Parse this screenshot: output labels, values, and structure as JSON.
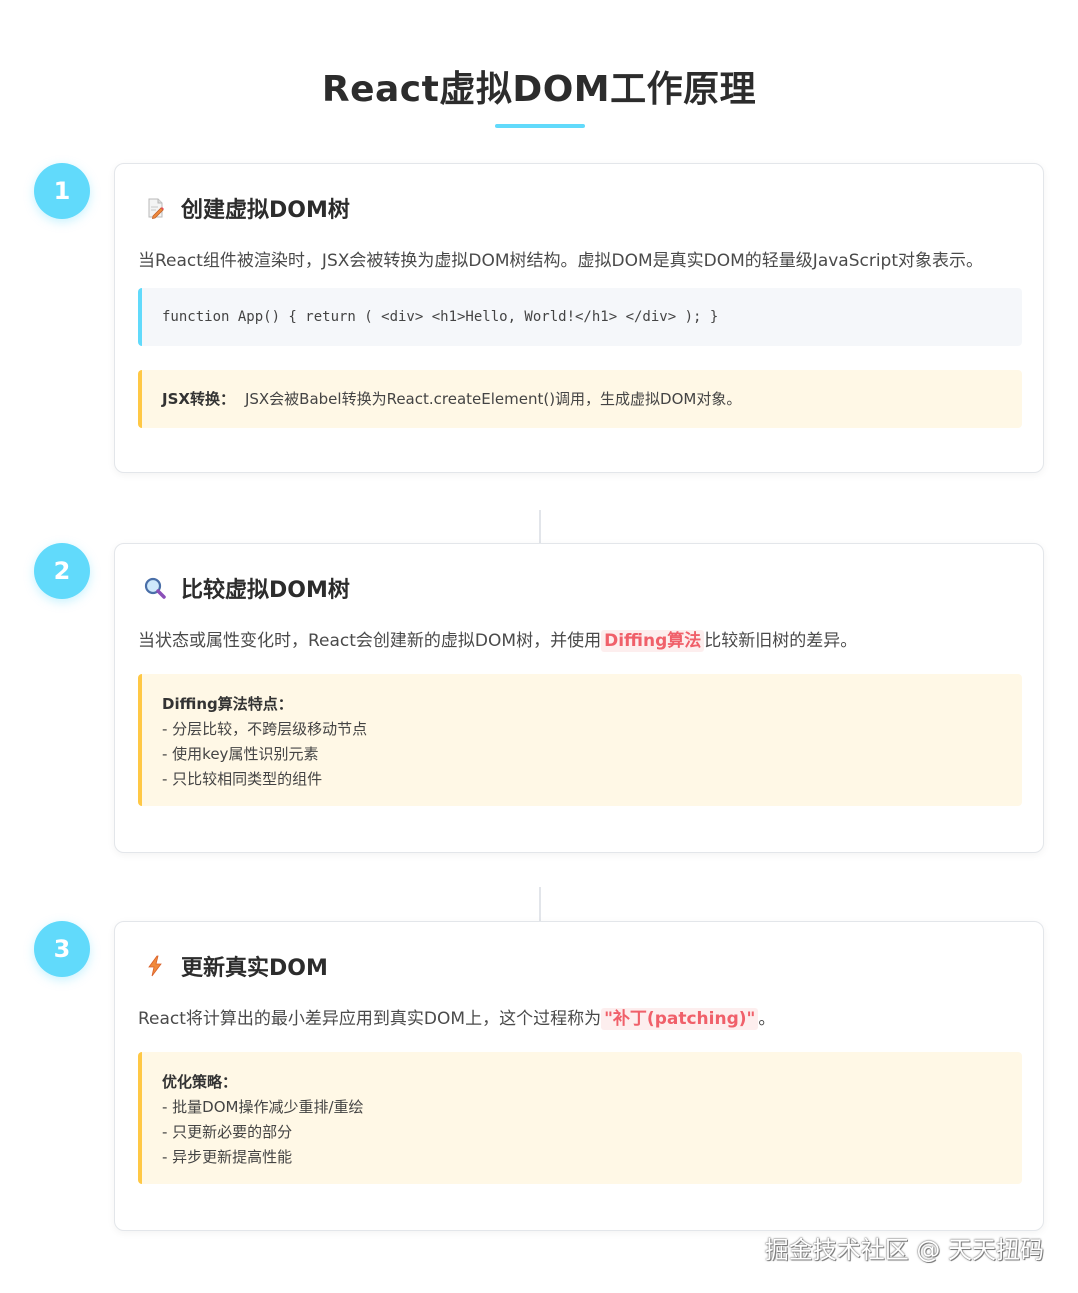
{
  "title": "React虚拟DOM工作原理",
  "steps": [
    {
      "number": "1",
      "icon": "memo-icon",
      "heading": "创建虚拟DOM树",
      "description": "当React组件被渲染时，JSX会被转换为虚拟DOM树结构。虚拟DOM是真实DOM的轻量级JavaScript对象表示。",
      "code": "function App() { return ( <div> <h1>Hello, World!</h1> </div> ); }",
      "note": {
        "title": "JSX转换：",
        "text": "JSX会被Babel转换为React.createElement()调用，生成虚拟DOM对象。"
      }
    },
    {
      "number": "2",
      "icon": "magnifier-icon",
      "heading": "比较虚拟DOM树",
      "description_before": "当状态或属性变化时，React会创建新的虚拟DOM树，并使用",
      "description_highlight": "Diffing算法",
      "description_after": "比较新旧树的差异。",
      "note": {
        "title": "Diffing算法特点：",
        "lines": [
          "- 分层比较，不跨层级移动节点",
          "- 使用key属性识别元素",
          "- 只比较相同类型的组件"
        ]
      }
    },
    {
      "number": "3",
      "icon": "lightning-icon",
      "heading": "更新真实DOM",
      "description_before": "React将计算出的最小差异应用到真实DOM上，这个过程称为",
      "description_highlight": "\"补丁(patching)\"",
      "description_after": "。",
      "note": {
        "title": "优化策略：",
        "lines": [
          "- 批量DOM操作减少重排/重绘",
          "- 只更新必要的部分",
          "- 异步更新提高性能"
        ]
      }
    }
  ],
  "watermark": "掘金技术社区 @ 天天扭码",
  "colors": {
    "accent": "#61dafb",
    "highlight_text": "#f0606a",
    "note_border": "#ffc845",
    "note_background": "#fff8e6"
  }
}
